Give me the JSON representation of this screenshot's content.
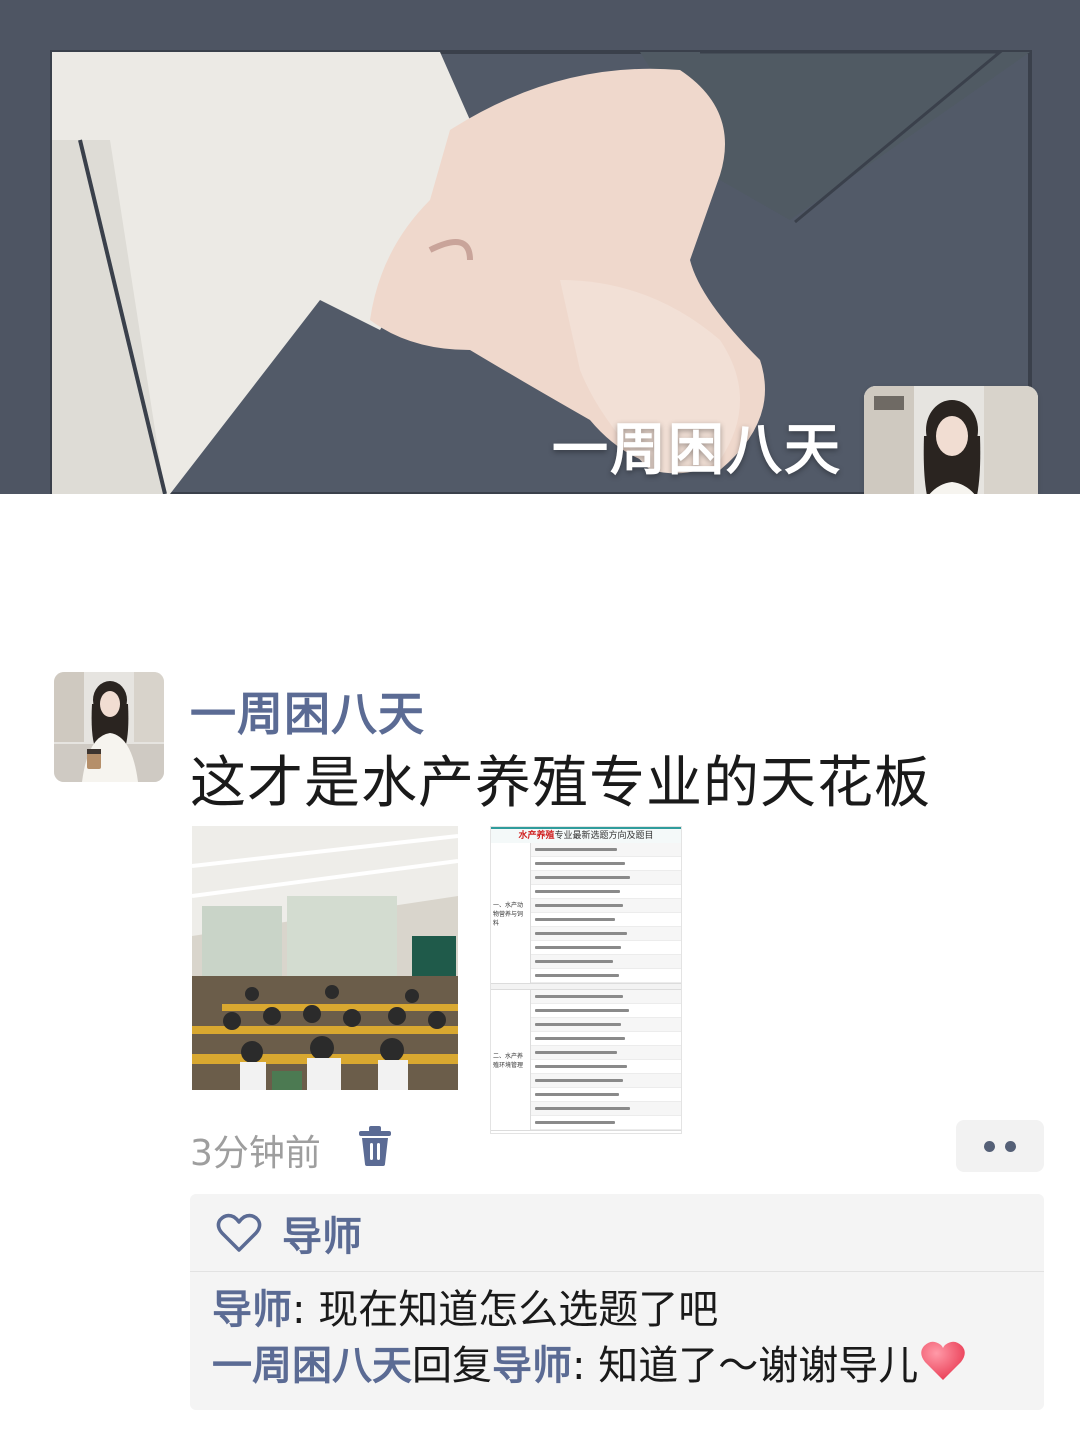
{
  "cover": {
    "username": "一周困八天"
  },
  "post": {
    "author": "一周困八天",
    "text": "这才是水产养殖专业的天花板",
    "time": "3分钟前",
    "document": {
      "title_highlight": "水产养殖",
      "title_rest": "专业最新选题方向及题目",
      "section1_label": "一、水产动物营养与饲料",
      "section2_label": "二、水产养殖环境管理"
    }
  },
  "interactions": {
    "like_name": "导师",
    "comments": [
      {
        "author": "导师",
        "separator": ": ",
        "text": "现在知道怎么选题了吧"
      },
      {
        "author": "一周困八天",
        "reply_word": "回复",
        "reply_to": "导师",
        "separator": ": ",
        "text": "知道了～谢谢导儿"
      }
    ]
  },
  "colors": {
    "name_link": "#5b6b94",
    "time_gray": "#9e9e9e",
    "cover_bg": "#4e5563",
    "box_bg": "#f4f4f4"
  },
  "icons": {
    "delete": "trash-icon",
    "like": "heart-outline-icon",
    "more": "more-dots-icon",
    "emoji": "heart-emoji-icon"
  }
}
